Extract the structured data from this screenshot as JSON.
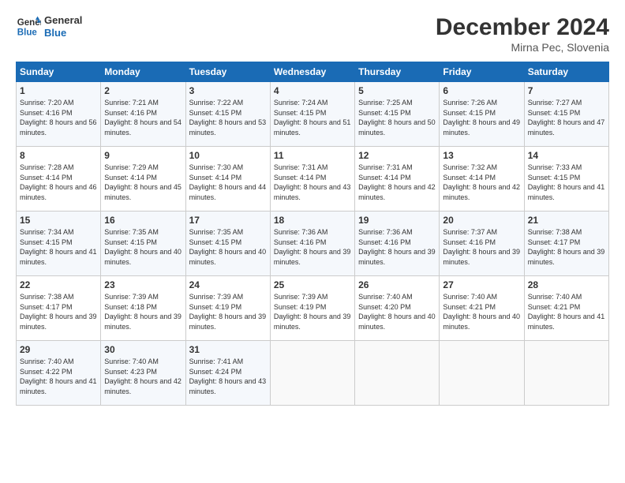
{
  "header": {
    "logo_line1": "General",
    "logo_line2": "Blue",
    "month_title": "December 2024",
    "subtitle": "Mirna Pec, Slovenia"
  },
  "days_of_week": [
    "Sunday",
    "Monday",
    "Tuesday",
    "Wednesday",
    "Thursday",
    "Friday",
    "Saturday"
  ],
  "weeks": [
    [
      {
        "day": "1",
        "sunrise": "Sunrise: 7:20 AM",
        "sunset": "Sunset: 4:16 PM",
        "daylight": "Daylight: 8 hours and 56 minutes."
      },
      {
        "day": "2",
        "sunrise": "Sunrise: 7:21 AM",
        "sunset": "Sunset: 4:16 PM",
        "daylight": "Daylight: 8 hours and 54 minutes."
      },
      {
        "day": "3",
        "sunrise": "Sunrise: 7:22 AM",
        "sunset": "Sunset: 4:15 PM",
        "daylight": "Daylight: 8 hours and 53 minutes."
      },
      {
        "day": "4",
        "sunrise": "Sunrise: 7:24 AM",
        "sunset": "Sunset: 4:15 PM",
        "daylight": "Daylight: 8 hours and 51 minutes."
      },
      {
        "day": "5",
        "sunrise": "Sunrise: 7:25 AM",
        "sunset": "Sunset: 4:15 PM",
        "daylight": "Daylight: 8 hours and 50 minutes."
      },
      {
        "day": "6",
        "sunrise": "Sunrise: 7:26 AM",
        "sunset": "Sunset: 4:15 PM",
        "daylight": "Daylight: 8 hours and 49 minutes."
      },
      {
        "day": "7",
        "sunrise": "Sunrise: 7:27 AM",
        "sunset": "Sunset: 4:15 PM",
        "daylight": "Daylight: 8 hours and 47 minutes."
      }
    ],
    [
      {
        "day": "8",
        "sunrise": "Sunrise: 7:28 AM",
        "sunset": "Sunset: 4:14 PM",
        "daylight": "Daylight: 8 hours and 46 minutes."
      },
      {
        "day": "9",
        "sunrise": "Sunrise: 7:29 AM",
        "sunset": "Sunset: 4:14 PM",
        "daylight": "Daylight: 8 hours and 45 minutes."
      },
      {
        "day": "10",
        "sunrise": "Sunrise: 7:30 AM",
        "sunset": "Sunset: 4:14 PM",
        "daylight": "Daylight: 8 hours and 44 minutes."
      },
      {
        "day": "11",
        "sunrise": "Sunrise: 7:31 AM",
        "sunset": "Sunset: 4:14 PM",
        "daylight": "Daylight: 8 hours and 43 minutes."
      },
      {
        "day": "12",
        "sunrise": "Sunrise: 7:31 AM",
        "sunset": "Sunset: 4:14 PM",
        "daylight": "Daylight: 8 hours and 42 minutes."
      },
      {
        "day": "13",
        "sunrise": "Sunrise: 7:32 AM",
        "sunset": "Sunset: 4:14 PM",
        "daylight": "Daylight: 8 hours and 42 minutes."
      },
      {
        "day": "14",
        "sunrise": "Sunrise: 7:33 AM",
        "sunset": "Sunset: 4:15 PM",
        "daylight": "Daylight: 8 hours and 41 minutes."
      }
    ],
    [
      {
        "day": "15",
        "sunrise": "Sunrise: 7:34 AM",
        "sunset": "Sunset: 4:15 PM",
        "daylight": "Daylight: 8 hours and 41 minutes."
      },
      {
        "day": "16",
        "sunrise": "Sunrise: 7:35 AM",
        "sunset": "Sunset: 4:15 PM",
        "daylight": "Daylight: 8 hours and 40 minutes."
      },
      {
        "day": "17",
        "sunrise": "Sunrise: 7:35 AM",
        "sunset": "Sunset: 4:15 PM",
        "daylight": "Daylight: 8 hours and 40 minutes."
      },
      {
        "day": "18",
        "sunrise": "Sunrise: 7:36 AM",
        "sunset": "Sunset: 4:16 PM",
        "daylight": "Daylight: 8 hours and 39 minutes."
      },
      {
        "day": "19",
        "sunrise": "Sunrise: 7:36 AM",
        "sunset": "Sunset: 4:16 PM",
        "daylight": "Daylight: 8 hours and 39 minutes."
      },
      {
        "day": "20",
        "sunrise": "Sunrise: 7:37 AM",
        "sunset": "Sunset: 4:16 PM",
        "daylight": "Daylight: 8 hours and 39 minutes."
      },
      {
        "day": "21",
        "sunrise": "Sunrise: 7:38 AM",
        "sunset": "Sunset: 4:17 PM",
        "daylight": "Daylight: 8 hours and 39 minutes."
      }
    ],
    [
      {
        "day": "22",
        "sunrise": "Sunrise: 7:38 AM",
        "sunset": "Sunset: 4:17 PM",
        "daylight": "Daylight: 8 hours and 39 minutes."
      },
      {
        "day": "23",
        "sunrise": "Sunrise: 7:39 AM",
        "sunset": "Sunset: 4:18 PM",
        "daylight": "Daylight: 8 hours and 39 minutes."
      },
      {
        "day": "24",
        "sunrise": "Sunrise: 7:39 AM",
        "sunset": "Sunset: 4:19 PM",
        "daylight": "Daylight: 8 hours and 39 minutes."
      },
      {
        "day": "25",
        "sunrise": "Sunrise: 7:39 AM",
        "sunset": "Sunset: 4:19 PM",
        "daylight": "Daylight: 8 hours and 39 minutes."
      },
      {
        "day": "26",
        "sunrise": "Sunrise: 7:40 AM",
        "sunset": "Sunset: 4:20 PM",
        "daylight": "Daylight: 8 hours and 40 minutes."
      },
      {
        "day": "27",
        "sunrise": "Sunrise: 7:40 AM",
        "sunset": "Sunset: 4:21 PM",
        "daylight": "Daylight: 8 hours and 40 minutes."
      },
      {
        "day": "28",
        "sunrise": "Sunrise: 7:40 AM",
        "sunset": "Sunset: 4:21 PM",
        "daylight": "Daylight: 8 hours and 41 minutes."
      }
    ],
    [
      {
        "day": "29",
        "sunrise": "Sunrise: 7:40 AM",
        "sunset": "Sunset: 4:22 PM",
        "daylight": "Daylight: 8 hours and 41 minutes."
      },
      {
        "day": "30",
        "sunrise": "Sunrise: 7:40 AM",
        "sunset": "Sunset: 4:23 PM",
        "daylight": "Daylight: 8 hours and 42 minutes."
      },
      {
        "day": "31",
        "sunrise": "Sunrise: 7:41 AM",
        "sunset": "Sunset: 4:24 PM",
        "daylight": "Daylight: 8 hours and 43 minutes."
      },
      null,
      null,
      null,
      null
    ]
  ]
}
